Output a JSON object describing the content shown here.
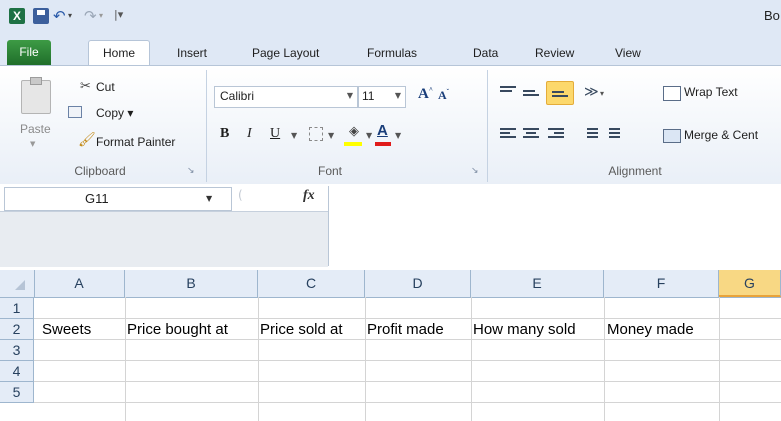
{
  "titlebar": {
    "app_icon_letter": "X",
    "title": "Bo",
    "qat_customize": "|▾"
  },
  "tabs": [
    "File",
    "Home",
    "Insert",
    "Page Layout",
    "Formulas",
    "Data",
    "Review",
    "View"
  ],
  "active_tab": "Home",
  "ribbon": {
    "clipboard": {
      "paste": "Paste",
      "cut": "Cut",
      "copy": "Copy ▾",
      "format_painter": "Format Painter",
      "group_label": "Clipboard"
    },
    "font": {
      "font_name": "Calibri",
      "font_size": "11",
      "grow": "A",
      "shrink": "A",
      "bold": "B",
      "italic": "I",
      "underline": "U",
      "font_color_glyph": "A",
      "fill_color": "#ffff00",
      "font_color": "#e01b1b",
      "group_label": "Font"
    },
    "alignment": {
      "wrap_text": "Wrap Text",
      "merge_center": "Merge & Cent",
      "group_label": "Alignment",
      "active_vertical_align": "bottom"
    }
  },
  "formula_bar": {
    "name_box": "G11",
    "fx": "fx",
    "formula": ""
  },
  "sheet": {
    "columns": [
      "A",
      "B",
      "C",
      "D",
      "E",
      "F",
      "G"
    ],
    "selected_column": "G",
    "rows": [
      "1",
      "2",
      "3",
      "4",
      "5"
    ],
    "cells": {
      "A2": "Sweets",
      "B2": "Price bought at",
      "C2": "Price sold at",
      "D2": "Profit made",
      "E2": "How many sold",
      "F2": "Money made"
    }
  }
}
